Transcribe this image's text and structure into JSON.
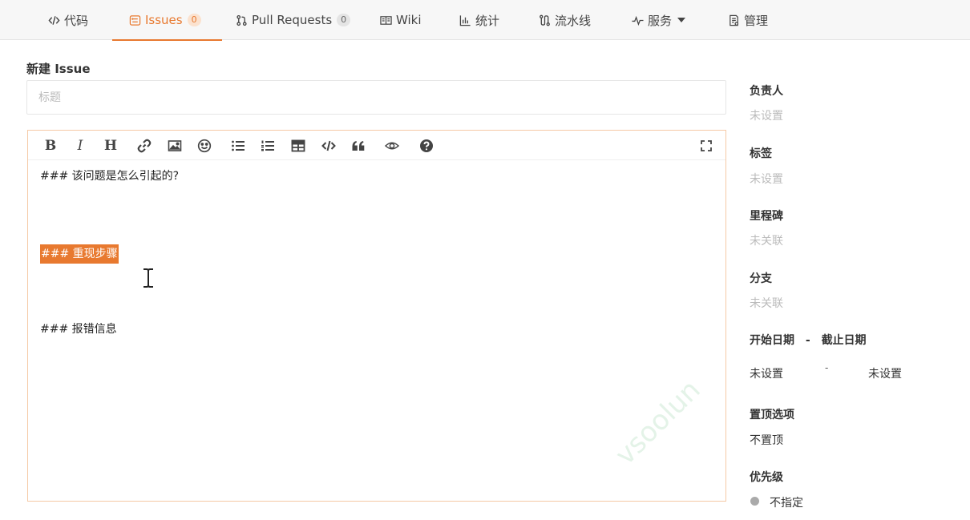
{
  "tabs": [
    {
      "label": "代码",
      "icon": "code-icon"
    },
    {
      "label": "Issues",
      "icon": "issue-icon",
      "count": "0",
      "active": true
    },
    {
      "label": "Pull Requests",
      "icon": "pull-request-icon",
      "count": "0"
    },
    {
      "label": "Wiki",
      "icon": "book-icon"
    },
    {
      "label": "统计",
      "icon": "bar-chart-icon"
    },
    {
      "label": "流水线",
      "icon": "pipeline-icon"
    },
    {
      "label": "服务",
      "icon": "pulse-icon",
      "dropdown": true
    },
    {
      "label": "管理",
      "icon": "settings-doc-icon"
    }
  ],
  "form": {
    "heading": "新建 Issue",
    "title_placeholder": "标题",
    "title_value": ""
  },
  "toolbar": {
    "bold": "B",
    "italic": "I",
    "heading": "H",
    "items": [
      "bold-icon",
      "italic-icon",
      "heading-icon",
      "link-icon",
      "image-icon",
      "emoji-icon",
      "unordered-list-icon",
      "ordered-list-icon",
      "table-icon",
      "code-icon",
      "quote-icon",
      "preview-icon",
      "help-icon",
      "fullscreen-icon"
    ]
  },
  "editor": {
    "lines": [
      "### 该问题是怎么引起的?",
      "### 重现步骤",
      "### 报错信息"
    ],
    "selected_line": 1
  },
  "sidebar": {
    "assignee": {
      "label": "负责人",
      "value": "未设置"
    },
    "labels": {
      "label": "标签",
      "value": "未设置"
    },
    "milestone": {
      "label": "里程碑",
      "value": "未关联"
    },
    "branch": {
      "label": "分支",
      "value": "未关联"
    },
    "dates": {
      "start_label": "开始日期",
      "separator": "-",
      "end_label": "截止日期",
      "start_value": "未设置",
      "value_separator": "-",
      "end_value": "未设置"
    },
    "pin": {
      "label": "置顶选项",
      "value": "不置顶"
    },
    "priority": {
      "label": "优先级",
      "value": "不指定"
    }
  },
  "watermark": "vsoolun",
  "colors": {
    "accent": "#e8792f",
    "selection": "#e8792f",
    "muted": "#bbbbbb",
    "priority_dot": "#aaaaaa"
  }
}
